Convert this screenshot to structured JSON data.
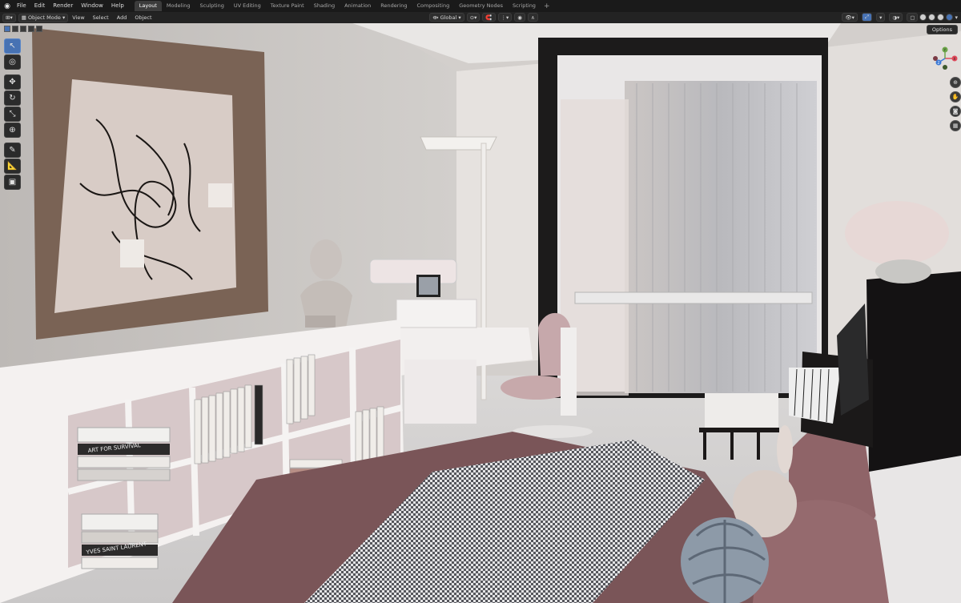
{
  "menus": [
    "File",
    "Edit",
    "Render",
    "Window",
    "Help"
  ],
  "workspaces": [
    {
      "label": "Layout",
      "active": true
    },
    {
      "label": "Modeling",
      "active": false
    },
    {
      "label": "Sculpting",
      "active": false
    },
    {
      "label": "UV Editing",
      "active": false
    },
    {
      "label": "Texture Paint",
      "active": false
    },
    {
      "label": "Shading",
      "active": false
    },
    {
      "label": "Animation",
      "active": false
    },
    {
      "label": "Rendering",
      "active": false
    },
    {
      "label": "Compositing",
      "active": false
    },
    {
      "label": "Geometry Nodes",
      "active": false
    },
    {
      "label": "Scripting",
      "active": false
    }
  ],
  "workspace_add": "+",
  "header": {
    "mode": "Object Mode",
    "view": "View",
    "select": "Select",
    "add": "Add",
    "object": "Object",
    "orientation": "Global"
  },
  "options_label": "Options",
  "gizmo": {
    "x": "X",
    "y": "Y",
    "z": "Z"
  },
  "tools": [
    {
      "name": "select-box-tool",
      "icon": "select-cursor-icon",
      "glyph": "↖",
      "active": true
    },
    {
      "name": "cursor-tool",
      "icon": "cursor-3d-icon",
      "glyph": "◎",
      "active": false
    },
    {
      "name": "move-tool",
      "icon": "move-icon",
      "glyph": "✥",
      "active": false
    },
    {
      "name": "rotate-tool",
      "icon": "rotate-icon",
      "glyph": "↻",
      "active": false
    },
    {
      "name": "scale-tool",
      "icon": "scale-icon",
      "glyph": "⤡",
      "active": false
    },
    {
      "name": "transform-tool",
      "icon": "transform-icon",
      "glyph": "⊕",
      "active": false
    },
    {
      "name": "annotate-tool",
      "icon": "annotate-icon",
      "glyph": "✎",
      "active": false
    },
    {
      "name": "measure-tool",
      "icon": "measure-icon",
      "glyph": "📐",
      "active": false
    },
    {
      "name": "add-cube-tool",
      "icon": "cube-icon",
      "glyph": "▣",
      "active": false
    }
  ],
  "book_spines": {
    "left_stack_1": "ART FOR SURVIVAL",
    "left_stack_2": "YVES SAINT LAURENT"
  },
  "colors": {
    "accent": "#4772b3",
    "topbar": "#1a1a1a",
    "header": "#232323"
  }
}
